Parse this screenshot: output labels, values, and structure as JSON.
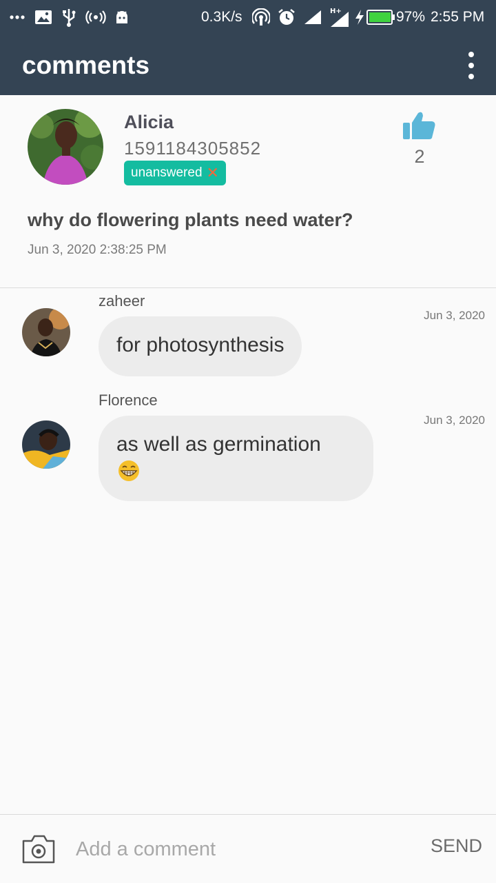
{
  "status_bar": {
    "speed": "0.3K/s",
    "battery": "97%",
    "time": "2:55 PM",
    "network": "H+"
  },
  "app_bar": {
    "title": "comments"
  },
  "question": {
    "author": "Alicia",
    "id": "1591184305852",
    "status": "unanswered",
    "likes": "2",
    "text": "why do flowering plants need water?",
    "date": "Jun 3, 2020 2:38:25 PM"
  },
  "comments": [
    {
      "author": "zaheer",
      "text": "for photosynthesis",
      "date": "Jun 3, 2020"
    },
    {
      "author": "Florence",
      "text": "as well as germination",
      "date": "Jun 3, 2020"
    }
  ],
  "composer": {
    "placeholder": "Add a comment",
    "send_label": "SEND"
  },
  "colors": {
    "bar": "#344454",
    "badge": "#14bca0",
    "like": "#5bb6d8",
    "battery": "#3fd23f"
  }
}
